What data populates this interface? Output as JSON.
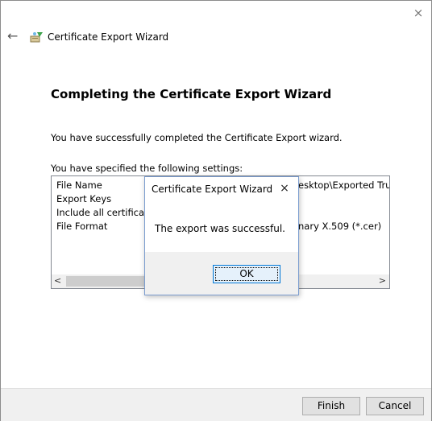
{
  "window": {
    "title": "Certificate Export Wizard",
    "close_glyph": "×",
    "back_glyph": "←"
  },
  "wizard": {
    "heading": "Completing the Certificate Export Wizard",
    "intro": "You have successfully completed the Certificate Export wizard.",
    "settings_label": "You have specified the following settings:",
    "settings": [
      {
        "name": "File Name",
        "value": "esktop\\Exported Trust"
      },
      {
        "name": "Export Keys",
        "value": ""
      },
      {
        "name": "Include all certificates i",
        "value": ""
      },
      {
        "name": "File Format",
        "value": "nary X.509 (*.cer)"
      }
    ],
    "scroll_left": "<",
    "scroll_right": ">"
  },
  "footer": {
    "finish_label": "Finish",
    "cancel_label": "Cancel"
  },
  "dialog": {
    "title": "Certificate Export Wizard",
    "close_glyph": "×",
    "message": "The export was successful.",
    "ok_label": "OK"
  },
  "icons": [
    "back-arrow-icon",
    "certificate-wizard-icon",
    "close-icon"
  ]
}
